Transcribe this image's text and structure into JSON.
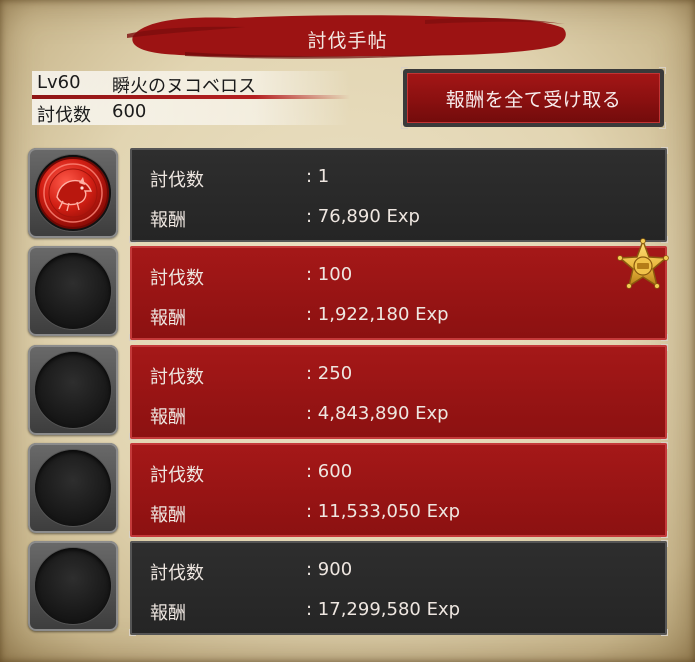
{
  "window": {
    "title": "討伐手帖"
  },
  "monster": {
    "level": "Lv60",
    "name": "瞬火のヌコベロス",
    "kill_count_label": "討伐数",
    "kill_count": "600"
  },
  "actions": {
    "claim_all_label": "報酬を全て受け取る"
  },
  "rewards": [
    {
      "count_label": "討伐数",
      "count_value": ": 1",
      "reward_label": "報酬",
      "reward_value": ": 76,890 Exp",
      "state": "claimed"
    },
    {
      "count_label": "討伐数",
      "count_value": ": 100",
      "reward_label": "報酬",
      "reward_value": ": 1,922,180 Exp",
      "state": "claimable"
    },
    {
      "count_label": "討伐数",
      "count_value": ": 250",
      "reward_label": "報酬",
      "reward_value": ": 4,843,890 Exp",
      "state": "claimable"
    },
    {
      "count_label": "討伐数",
      "count_value": ": 600",
      "reward_label": "報酬",
      "reward_value": ": 11,533,050 Exp",
      "state": "claimable"
    },
    {
      "count_label": "討伐数",
      "count_value": ": 900",
      "reward_label": "報酬",
      "reward_value": ": 17,299,580 Exp",
      "state": "locked"
    }
  ],
  "icons": {
    "medal": "monster-seal-medal-icon",
    "new_badge": "star-badge-icon"
  },
  "colors": {
    "accent_red": "#9a1414",
    "panel_dark": "#2a2a2a",
    "parchment": "#e6dab9",
    "star_gold": "#e8b43a"
  }
}
